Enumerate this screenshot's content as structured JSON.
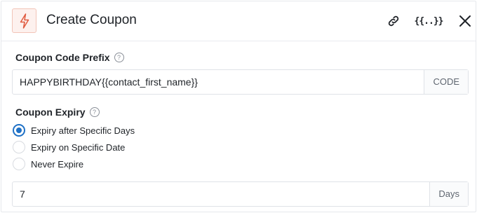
{
  "header": {
    "title": "Create Coupon",
    "icon": "lightning-bolt-icon",
    "accent_color": "#e05a3f",
    "merge_tag_label": "{{..}}"
  },
  "coupon_prefix": {
    "label": "Coupon Code Prefix",
    "help": "?",
    "value": "HAPPYBIRTHDAY{{contact_first_name}}",
    "suffix": "CODE"
  },
  "coupon_expiry": {
    "label": "Coupon Expiry",
    "help": "?",
    "options": [
      {
        "label": "Expiry after Specific Days",
        "selected": true
      },
      {
        "label": "Expiry on Specific Date",
        "selected": false
      },
      {
        "label": "Never Expire",
        "selected": false
      }
    ],
    "days_value": "7",
    "days_suffix": "Days"
  }
}
